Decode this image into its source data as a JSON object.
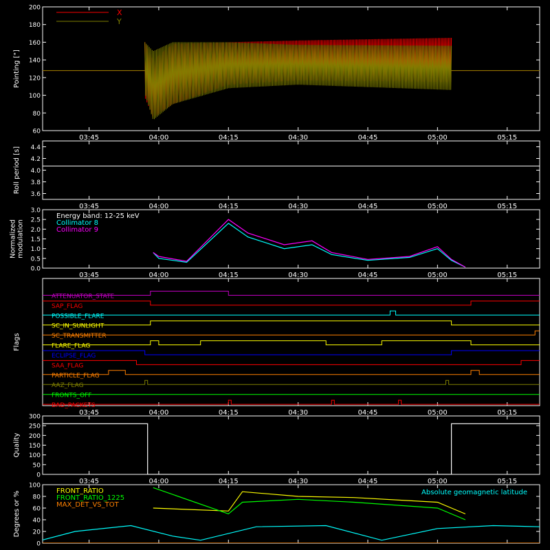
{
  "colors": {
    "background": "#000000",
    "axis": "#ffffff",
    "red": "#ff0000",
    "olive": "#808000",
    "cyan": "#00ffff",
    "magenta": "#ff00ff",
    "white": "#ffffff",
    "yellow": "#ffff00",
    "green": "#00ff00",
    "orange": "#ff8000",
    "blue": "#0000ff",
    "purple": "#c000c0"
  },
  "chart_data": [
    {
      "id": "pointing",
      "type": "line",
      "ylabel": "Pointing [\"]",
      "xlim": [
        "03:35",
        "05:22"
      ],
      "xticks": [
        "03:45",
        "04:00",
        "04:15",
        "04:30",
        "04:45",
        "05:00",
        "05:15"
      ],
      "ylim": [
        60,
        200
      ],
      "yticks": [
        "60",
        "80",
        "100",
        "120",
        "140",
        "160",
        "180",
        "200"
      ],
      "legend": [
        {
          "name": "X",
          "color": "#ff0000"
        },
        {
          "name": "Y",
          "color": "#808000"
        }
      ],
      "series": [
        {
          "name": "X",
          "color": "#ff0000",
          "baseline": 128,
          "active_start": "03:57",
          "active_end": "05:03",
          "envelope_upper": [
            [
              3.95,
              160
            ],
            [
              3.98,
              140
            ],
            [
              4.05,
              158
            ],
            [
              4.25,
              160
            ],
            [
              4.5,
              162
            ],
            [
              5.05,
              165
            ]
          ],
          "envelope_lower": [
            [
              3.95,
              98
            ],
            [
              3.98,
              75
            ],
            [
              4.05,
              90
            ],
            [
              4.25,
              112
            ],
            [
              4.5,
              117
            ],
            [
              5.05,
              115
            ]
          ]
        },
        {
          "name": "Y",
          "color": "#808000",
          "baseline": 128,
          "active_start": "03:57",
          "active_end": "05:03",
          "envelope_upper": [
            [
              3.95,
              160
            ],
            [
              3.98,
              150
            ],
            [
              4.05,
              160
            ],
            [
              4.25,
              160
            ],
            [
              4.5,
              157
            ],
            [
              5.05,
              156
            ]
          ],
          "envelope_lower": [
            [
              3.95,
              102
            ],
            [
              3.98,
              72
            ],
            [
              4.05,
              90
            ],
            [
              4.25,
              108
            ],
            [
              4.5,
              112
            ],
            [
              5.05,
              106
            ]
          ]
        }
      ]
    },
    {
      "id": "roll",
      "type": "line",
      "ylabel": "Roll period [s]",
      "xticks": [
        "03:45",
        "04:00",
        "04:15",
        "04:30",
        "04:45",
        "05:00",
        "05:15"
      ],
      "ylim": [
        3.5,
        4.5
      ],
      "yticks": [
        "3.6",
        "3.8",
        "4.0",
        "4.2",
        "4.4"
      ],
      "series": [
        {
          "name": "roll",
          "color": "#ffffff",
          "value": 4.07
        }
      ]
    },
    {
      "id": "modulation",
      "type": "line",
      "ylabel": "Normalized modulation",
      "ylabel_lines": [
        "Normalized",
        "modulation"
      ],
      "xticks": [
        "03:45",
        "04:00",
        "04:15",
        "04:30",
        "04:45",
        "05:00",
        "05:15"
      ],
      "ylim": [
        0.0,
        3.0
      ],
      "yticks": [
        "0.0",
        "0.5",
        "1.0",
        "1.5",
        "2.0",
        "2.5",
        "3.0"
      ],
      "legend": [
        {
          "name": "Energy band: 12-25 keV",
          "color": "#ffffff"
        },
        {
          "name": "Collimator 8",
          "color": "#00ffff"
        },
        {
          "name": "Collimator 9",
          "color": "#ff00ff"
        }
      ],
      "series": [
        {
          "name": "Collimator 8",
          "color": "#00ffff",
          "points": [
            [
              3.98,
              0.8
            ],
            [
              4.0,
              0.5
            ],
            [
              4.1,
              0.3
            ],
            [
              4.25,
              2.3
            ],
            [
              4.32,
              1.6
            ],
            [
              4.45,
              1.0
            ],
            [
              4.55,
              1.2
            ],
            [
              4.62,
              0.7
            ],
            [
              4.75,
              0.4
            ],
            [
              4.9,
              0.55
            ],
            [
              5.0,
              1.0
            ],
            [
              5.05,
              0.4
            ],
            [
              5.1,
              0.05
            ]
          ]
        },
        {
          "name": "Collimator 9",
          "color": "#ff00ff",
          "points": [
            [
              3.98,
              0.8
            ],
            [
              4.0,
              0.6
            ],
            [
              4.1,
              0.35
            ],
            [
              4.25,
              2.5
            ],
            [
              4.32,
              1.8
            ],
            [
              4.45,
              1.2
            ],
            [
              4.55,
              1.4
            ],
            [
              4.62,
              0.8
            ],
            [
              4.75,
              0.45
            ],
            [
              4.9,
              0.6
            ],
            [
              5.0,
              1.1
            ],
            [
              5.05,
              0.45
            ],
            [
              5.1,
              0.05
            ]
          ]
        }
      ]
    },
    {
      "id": "flags",
      "type": "line",
      "ylabel": "Flags",
      "xticks": [
        "03:45",
        "04:00",
        "04:15",
        "04:30",
        "04:45",
        "05:00",
        "05:15"
      ],
      "rows": [
        {
          "name": "ATTENUATOR_STATE",
          "color": "#c000c0",
          "segments": [
            [
              3.97,
              4.25
            ]
          ]
        },
        {
          "name": "SAP_FLAG",
          "color": "#ff0000",
          "segments": [
            [
              3.58,
              3.97
            ],
            [
              5.12,
              5.37
            ]
          ]
        },
        {
          "name": "POSSIBLE_FLARE",
          "color": "#00ffff",
          "segments": [
            [
              4.83,
              4.85
            ]
          ]
        },
        {
          "name": "SC_IN_SUNLIGHT",
          "color": "#ffff00",
          "segments": [
            [
              3.97,
              5.05
            ]
          ]
        },
        {
          "name": "SC_TRANSMITTER",
          "color": "#ff8000",
          "segments": [
            [
              5.35,
              5.37
            ]
          ]
        },
        {
          "name": "FLARE_FLAG",
          "color": "#ffff00",
          "segments": [
            [
              3.97,
              4.0
            ],
            [
              4.15,
              4.6
            ],
            [
              4.8,
              5.12
            ]
          ]
        },
        {
          "name": "ECLIPSE_FLAG",
          "color": "#0000ff",
          "segments": [
            [
              3.58,
              3.95
            ],
            [
              5.05,
              5.37
            ]
          ]
        },
        {
          "name": "SAA_FLAG",
          "color": "#ff0000",
          "segments": [
            [
              3.58,
              3.92
            ],
            [
              5.3,
              5.37
            ]
          ]
        },
        {
          "name": "PARTICLE_FLAG",
          "color": "#ff8000",
          "segments": [
            [
              3.82,
              3.88
            ],
            [
              5.12,
              5.15
            ]
          ]
        },
        {
          "name": "AAZ_FLAG",
          "color": "#808000",
          "segments": [
            [
              3.95,
              3.96
            ],
            [
              5.03,
              5.04
            ]
          ]
        },
        {
          "name": "FRONTS_OFF",
          "color": "#00ff00",
          "segments": []
        },
        {
          "name": "BAD_PACKETS",
          "color": "#ff0000",
          "segments": [
            [
              4.25,
              4.26
            ],
            [
              4.62,
              4.63
            ],
            [
              4.86,
              4.87
            ]
          ]
        }
      ]
    },
    {
      "id": "quality",
      "type": "line",
      "ylabel": "Quality",
      "xticks": [
        "03:45",
        "04:00",
        "04:15",
        "04:30",
        "04:45",
        "05:00",
        "05:15"
      ],
      "ylim": [
        0,
        300
      ],
      "yticks": [
        "0",
        "50",
        "100",
        "150",
        "200",
        "250",
        "300"
      ],
      "series": [
        {
          "name": "quality",
          "color": "#ffffff",
          "points": [
            [
              3.58,
              260
            ],
            [
              3.96,
              260
            ],
            [
              3.96,
              0
            ],
            [
              5.05,
              0
            ],
            [
              5.05,
              260
            ],
            [
              5.37,
              260
            ]
          ]
        }
      ]
    },
    {
      "id": "ratios",
      "type": "line",
      "ylabel": "Degrees or %",
      "xticks": [
        "03:45",
        "04:00",
        "04:15",
        "04:30",
        "04:45",
        "05:00",
        "05:15"
      ],
      "ylim": [
        0,
        100
      ],
      "yticks": [
        "0",
        "20",
        "40",
        "60",
        "80",
        "100"
      ],
      "legend": [
        {
          "name": "FRONT_RATIO",
          "color": "#ffff00"
        },
        {
          "name": "FRONT_RATIO_1225",
          "color": "#00ff00"
        },
        {
          "name": "MAX_DET_VS_TOT",
          "color": "#ff8000"
        }
      ],
      "annotation": {
        "text": "Absolute geomagnetic latitude",
        "color": "#00ffff"
      },
      "series": [
        {
          "name": "FRONT_RATIO",
          "color": "#ffff00",
          "points": [
            [
              3.98,
              60
            ],
            [
              4.25,
              55
            ],
            [
              4.3,
              88
            ],
            [
              4.5,
              80
            ],
            [
              4.7,
              78
            ],
            [
              5.0,
              70
            ],
            [
              5.1,
              50
            ]
          ]
        },
        {
          "name": "FRONT_RATIO_1225",
          "color": "#00ff00",
          "points": [
            [
              3.98,
              95
            ],
            [
              4.25,
              50
            ],
            [
              4.3,
              70
            ],
            [
              4.5,
              75
            ],
            [
              4.7,
              70
            ],
            [
              5.0,
              60
            ],
            [
              5.1,
              40
            ]
          ]
        },
        {
          "name": "Absolute geomagnetic latitude",
          "color": "#00ffff",
          "points": [
            [
              3.58,
              5
            ],
            [
              3.7,
              20
            ],
            [
              3.9,
              30
            ],
            [
              4.05,
              12
            ],
            [
              4.15,
              5
            ],
            [
              4.35,
              28
            ],
            [
              4.6,
              30
            ],
            [
              4.8,
              5
            ],
            [
              5.0,
              25
            ],
            [
              5.2,
              30
            ],
            [
              5.37,
              28
            ]
          ]
        },
        {
          "name": "MAX_DET_VS_TOT",
          "color": "#ff8000",
          "points": [
            [
              3.58,
              0
            ],
            [
              5.37,
              0
            ]
          ]
        }
      ]
    }
  ]
}
